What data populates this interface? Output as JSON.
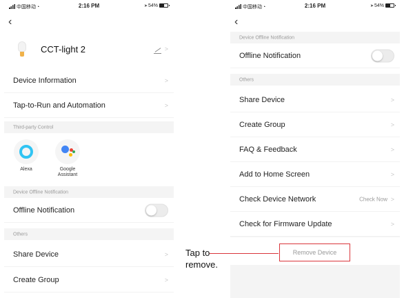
{
  "status_bar": {
    "carrier": "中国移动",
    "time": "2:16 PM",
    "battery": "54%"
  },
  "left_screen": {
    "device_name": "CCT-light 2",
    "rows": {
      "device_information": "Device Information",
      "tap_to_run": "Tap-to-Run and Automation",
      "offline_notification": "Offline Notification",
      "share_device": "Share Device",
      "create_group": "Create Group"
    },
    "sections": {
      "third_party": "Third-party Control",
      "offline": "Device Offline Notification",
      "others": "Others"
    },
    "third_party": [
      {
        "label": "Alexa",
        "icon": "alexa-icon"
      },
      {
        "label": "Google\nAssistant",
        "icon": "google-assistant-icon"
      }
    ],
    "offline_toggle_on": false
  },
  "right_screen": {
    "sections": {
      "offline": "Device Offline Notification",
      "others": "Others"
    },
    "rows": {
      "offline_notification": "Offline Notification",
      "share_device": "Share Device",
      "create_group": "Create Group",
      "faq": "FAQ & Feedback",
      "add_home": "Add to Home Screen",
      "check_network": "Check Device Network",
      "check_network_value": "Check Now",
      "firmware": "Check for Firmware Update"
    },
    "remove_button": "Remove Device",
    "offline_toggle_on": false
  },
  "annotation": {
    "text": "Tap to\nremove."
  },
  "colors": {
    "highlight": "#d9343a",
    "section_bg": "#f4f4f4"
  }
}
